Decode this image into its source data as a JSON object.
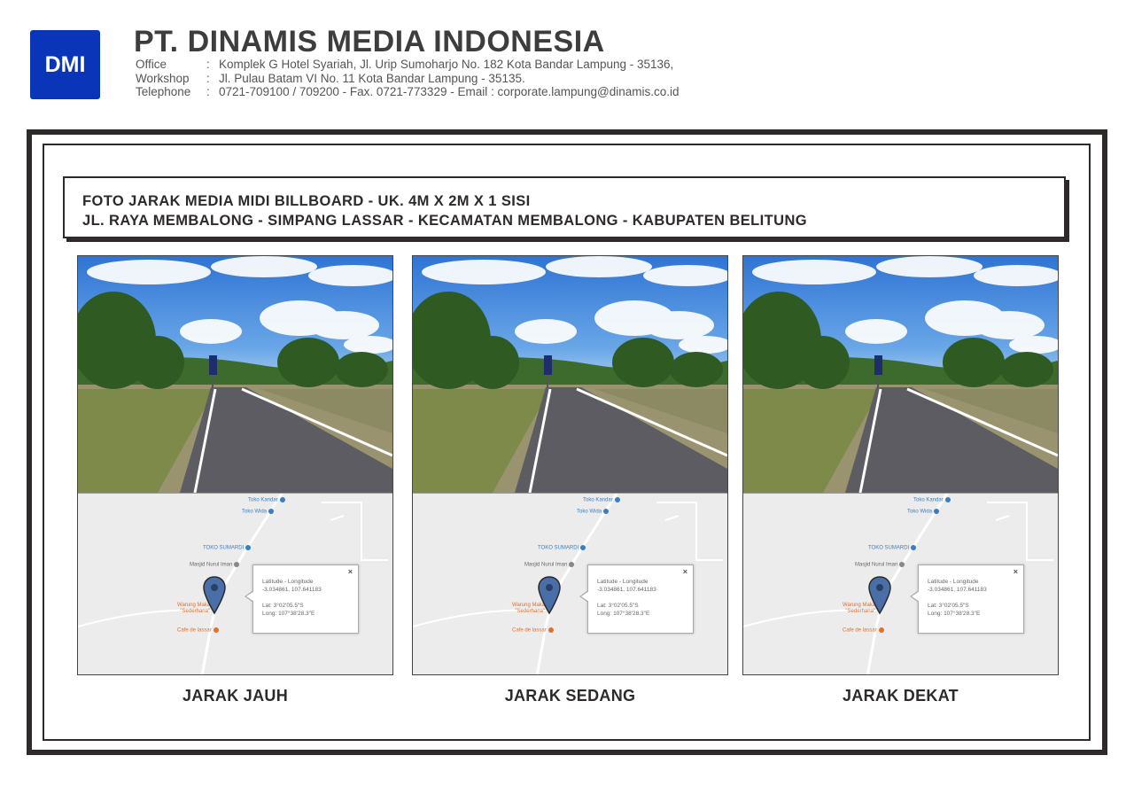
{
  "header": {
    "logo_text": "DMI",
    "company": "PT. DINAMIS MEDIA INDONESIA",
    "rows": [
      {
        "label": "Office",
        "sep": ":",
        "value": "Komplek G Hotel Syariah, Jl. Urip  Sumoharjo No. 182 Kota Bandar Lampung - 35136,"
      },
      {
        "label": "Workshop",
        "sep": ":",
        "value": "Jl. Pulau Batam  VI  No. 11 Kota Bandar Lampung - 35135."
      },
      {
        "label": "Telephone",
        "sep": ":",
        "value": "0721-709100 / 709200 - Fax. 0721-773329 - Email : corporate.lampung@dinamis.co.id"
      }
    ]
  },
  "title": {
    "line1": "FOTO JARAK MEDIA MIDI BILLBOARD - UK. 4M X 2M X 1 SISI",
    "line2": "JL. RAYA MEMBALONG - SIMPANG LASSAR - KECAMATAN MEMBALONG - KABUPATEN BELITUNG"
  },
  "map": {
    "poi_1": "Toko Kandar",
    "poi_2": "Toko Wida",
    "poi_3": "TOKO SUMARDI",
    "poi_4": "Masjid Nurul Iman",
    "poi_5_line1": "Warung Makan",
    "poi_5_line2": "\"Sederhana\"",
    "poi_6": "Cafe de lassar",
    "popup_heading": "Latitude - Longitude",
    "popup_coords": "-3.034861, 107.641183",
    "popup_lat": "Lat: 3°02'05.5\"S",
    "popup_long": "Long: 107°38'28.3\"E",
    "popup_close": "×"
  },
  "panels": [
    {
      "caption": "JARAK JAUH"
    },
    {
      "caption": "JARAK SEDANG"
    },
    {
      "caption": "JARAK DEKAT"
    }
  ],
  "colors": {
    "logo_blue": "#0b35b8",
    "frame": "#2e2a2a",
    "sky": "#3a7fd8",
    "road": "#5c5c62",
    "map_bg": "#ececec",
    "marker": "#4a6fa8"
  }
}
